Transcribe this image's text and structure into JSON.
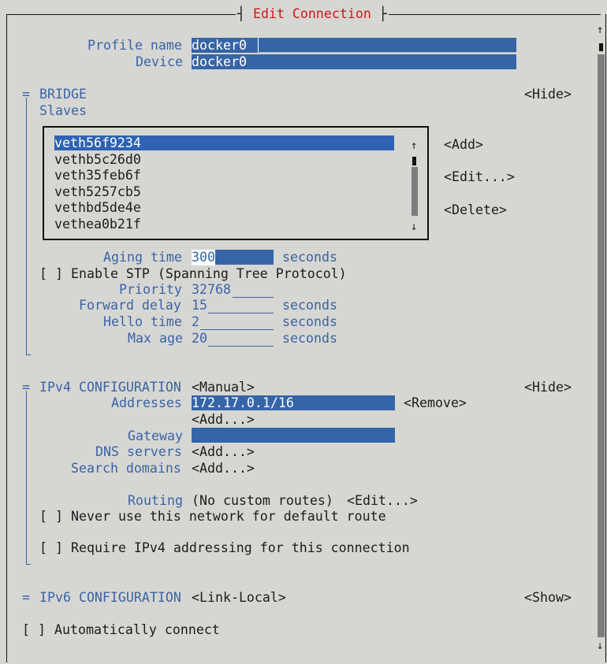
{
  "window": {
    "title": "Edit Connection",
    "scroll_up": "↑",
    "scroll_down": "↓"
  },
  "profile": {
    "name_label": "Profile name",
    "name_value": "docker0",
    "device_label": "Device",
    "device_value": "docker0"
  },
  "bridge": {
    "marker": "=",
    "heading": "BRIDGE",
    "hide": "<Hide>",
    "slaves_label": "Slaves",
    "slaves": [
      "veth56f9234",
      "vethb5c26d0",
      "veth35feb6f",
      "veth5257cb5",
      "vethbd5de4e",
      "vethea0b21f"
    ],
    "list_up": "↑",
    "list_down": "↓",
    "add": "<Add>",
    "edit": "<Edit...>",
    "delete": "<Delete>",
    "aging_label": "Aging time",
    "aging_value": "300",
    "aging_unit": "seconds",
    "stp_checkbox": "[ ]",
    "stp_label": "Enable STP (Spanning Tree Protocol)",
    "priority_label": "Priority",
    "priority_value": "32768",
    "forward_label": "Forward delay",
    "forward_value": "15",
    "forward_unit": "seconds",
    "hello_label": "Hello time",
    "hello_value": "2",
    "hello_unit": "seconds",
    "maxage_label": "Max age",
    "maxage_value": "20",
    "maxage_unit": "seconds"
  },
  "ipv4": {
    "marker": "=",
    "heading": "IPv4 CONFIGURATION",
    "method": "<Manual>",
    "hide": "<Hide>",
    "addresses_label": "Addresses",
    "address_value": "172.17.0.1/16",
    "remove": "<Remove>",
    "add_address": "<Add...>",
    "gateway_label": "Gateway",
    "gateway_value": "",
    "dns_label": "DNS servers",
    "dns_add": "<Add...>",
    "search_label": "Search domains",
    "search_add": "<Add...>",
    "routing_label": "Routing",
    "routing_value": "(No custom routes)",
    "routing_edit": "<Edit...>",
    "never_default_checkbox": "[ ]",
    "never_default_label": "Never use this network for default route",
    "require_checkbox": "[ ]",
    "require_label": "Require IPv4 addressing for this connection"
  },
  "ipv6": {
    "marker": "=",
    "heading": "IPv6 CONFIGURATION",
    "method": "<Link-Local>",
    "show": "<Show>"
  },
  "auto_connect": {
    "checkbox": "[ ]",
    "label": "Automatically connect"
  },
  "colors": {
    "background": "#d6d6d3",
    "accent_blue": "#3b64a3",
    "field_blue": "#3565a7",
    "title_red": "#cc1818"
  }
}
